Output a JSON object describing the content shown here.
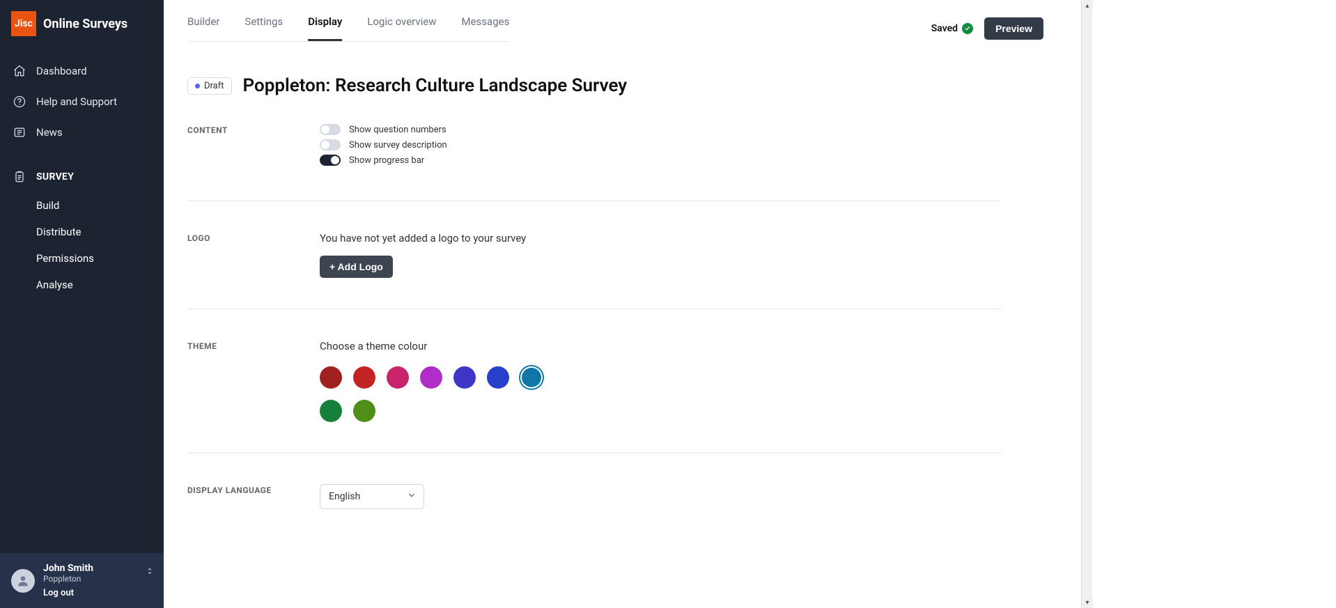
{
  "brand": {
    "logo_text": "Jisc",
    "title": "Online Surveys"
  },
  "nav": {
    "dashboard": "Dashboard",
    "help": "Help and Support",
    "news": "News",
    "survey_head": "SURVEY",
    "build": "Build",
    "distribute": "Distribute",
    "permissions": "Permissions",
    "analyse": "Analyse"
  },
  "user": {
    "name": "John Smith",
    "org": "Poppleton",
    "logout": "Log out"
  },
  "tabs": {
    "builder": "Builder",
    "settings": "Settings",
    "display": "Display",
    "logic": "Logic overview",
    "messages": "Messages",
    "active": "display"
  },
  "top": {
    "saved": "Saved",
    "preview": "Preview"
  },
  "header": {
    "badge": "Draft",
    "title": "Poppleton: Research Culture Landscape Survey"
  },
  "sections": {
    "content": {
      "label": "CONTENT",
      "opt_numbers": "Show question numbers",
      "opt_description": "Show survey description",
      "opt_progress": "Show progress bar",
      "values": {
        "numbers": false,
        "description": false,
        "progress": true
      }
    },
    "logo": {
      "label": "LOGO",
      "note": "You have not yet added a logo to your survey",
      "button": "+ Add Logo"
    },
    "theme": {
      "label": "THEME",
      "note": "Choose a theme colour",
      "colors": [
        "#a12020",
        "#c22323",
        "#c9236b",
        "#b02ec7",
        "#3f36c7",
        "#2640cc",
        "#0f77a8",
        "#157f3b",
        "#4f8f19"
      ],
      "selected_index": 6
    },
    "language": {
      "label": "DISPLAY LANGUAGE",
      "value": "English"
    }
  }
}
